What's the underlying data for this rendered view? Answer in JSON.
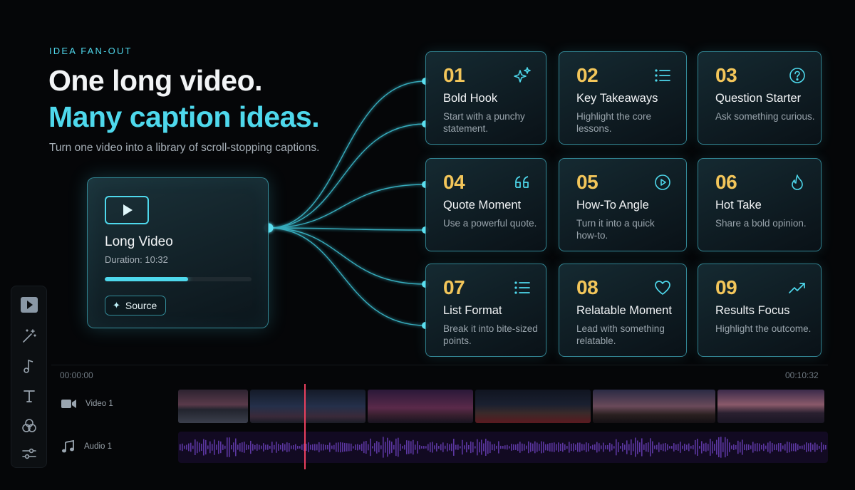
{
  "hero": {
    "eyebrow": "IDEA FAN-OUT",
    "title_line1": "One long video.",
    "title_line2": "Many caption ideas.",
    "subtitle": "Turn one video into a library of scroll-stopping captions."
  },
  "source": {
    "title": "Long Video",
    "duration": "Duration: 10:32",
    "progress": 0.57,
    "pill_label": "Source"
  },
  "cards": [
    {
      "num": "01",
      "title": "Bold Hook",
      "desc": "Start with a punchy statement.",
      "icon": "sparkle-icon"
    },
    {
      "num": "02",
      "title": "Key Takeaways",
      "desc": "Highlight the core lessons.",
      "icon": "list-icon"
    },
    {
      "num": "03",
      "title": "Question Starter",
      "desc": "Ask something curious.",
      "icon": "question-icon"
    },
    {
      "num": "04",
      "title": "Quote Moment",
      "desc": "Use a powerful quote.",
      "icon": "quote-icon"
    },
    {
      "num": "05",
      "title": "How-To Angle",
      "desc": "Turn it into a quick how-to.",
      "icon": "play-circle-icon"
    },
    {
      "num": "06",
      "title": "Hot Take",
      "desc": "Share a bold opinion.",
      "icon": "flame-icon"
    },
    {
      "num": "07",
      "title": "List Format",
      "desc": "Break it into bite-sized points.",
      "icon": "list-icon"
    },
    {
      "num": "08",
      "title": "Relatable Moment",
      "desc": "Lead with something relatable.",
      "icon": "heart-icon"
    },
    {
      "num": "09",
      "title": "Results Focus",
      "desc": "Highlight the outcome.",
      "icon": "trend-up-icon"
    }
  ],
  "sidebar": [
    "play-icon",
    "magic-wand-icon",
    "music-note-icon",
    "text-icon",
    "effects-icon",
    "sliders-icon"
  ],
  "timeline": {
    "start_time": "00:00:00",
    "end_time": "00:10:32",
    "tracks": [
      {
        "label": "Video 1",
        "icon": "video-camera-icon"
      },
      {
        "label": "Audio 1",
        "icon": "music-note-icon"
      }
    ]
  },
  "colors": {
    "accent": "#4ed8ec",
    "number": "#f3c65a",
    "playhead": "#e9405e",
    "background": "#050608"
  }
}
